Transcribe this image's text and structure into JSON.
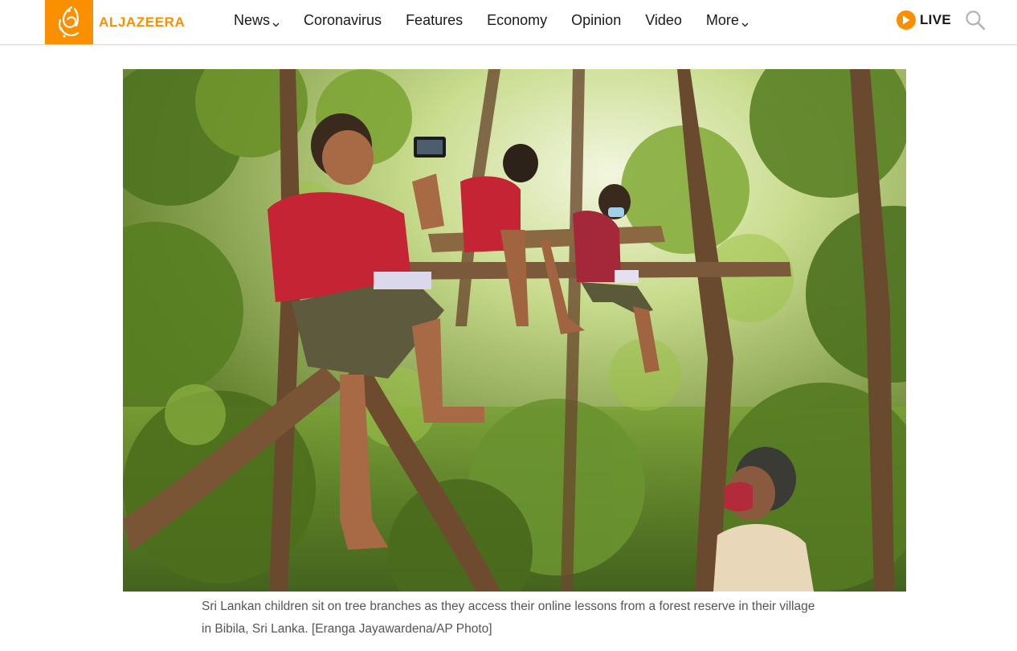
{
  "header": {
    "logo_text": "ALJAZEERA",
    "logo_icon": "al-jazeera-calligraphy-logo",
    "nav": [
      {
        "label": "News",
        "has_dropdown": true
      },
      {
        "label": "Coronavirus",
        "has_dropdown": false
      },
      {
        "label": "Features",
        "has_dropdown": false
      },
      {
        "label": "Economy",
        "has_dropdown": false
      },
      {
        "label": "Opinion",
        "has_dropdown": false
      },
      {
        "label": "Video",
        "has_dropdown": false
      },
      {
        "label": "More",
        "has_dropdown": true
      }
    ],
    "live_label": "LIVE",
    "live_icon": "play-icon",
    "search_icon": "search-icon"
  },
  "figure": {
    "caption": "Sri Lankan children sit on tree branches as they access their online lessons from a forest reserve in their village in Bibila, Sri Lanka. [Eranga Jayawardena/AP Photo]"
  },
  "colors": {
    "brand": "#fa9000",
    "text": "#1a1a1a",
    "caption": "#555555"
  }
}
